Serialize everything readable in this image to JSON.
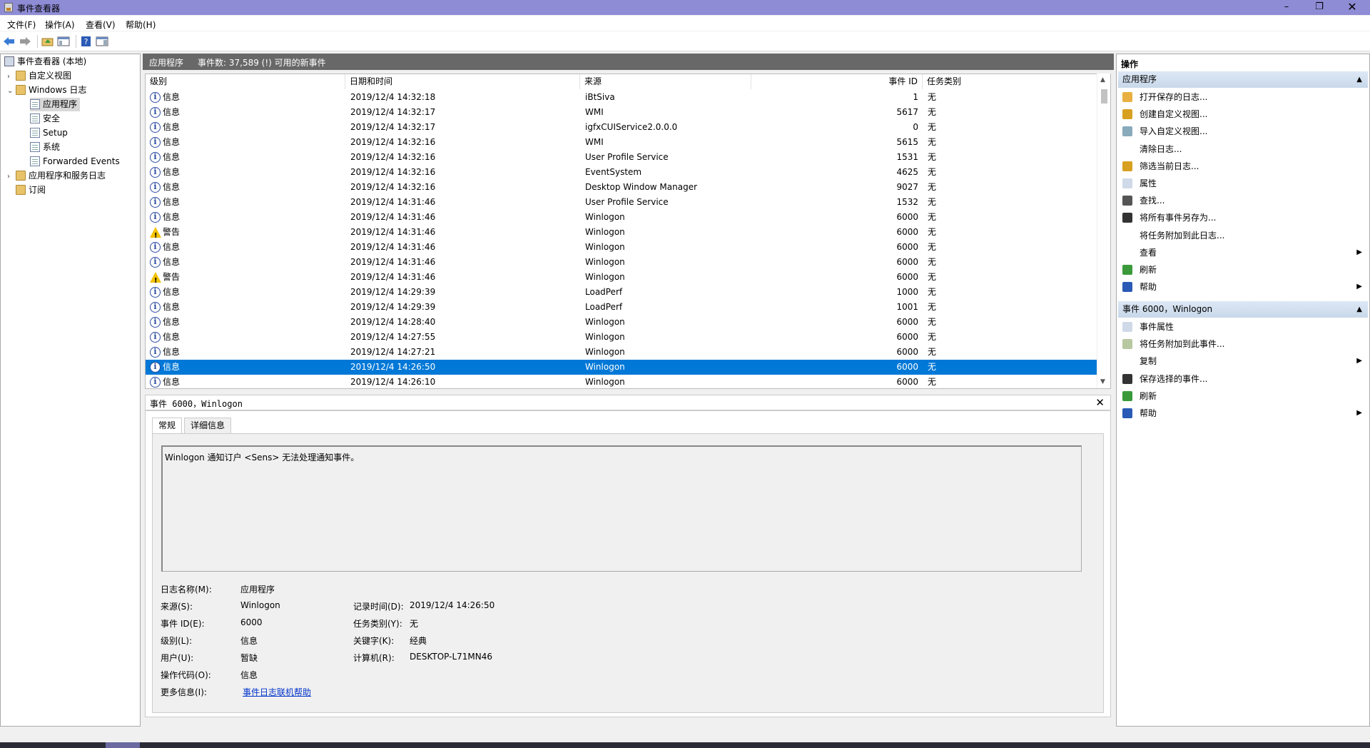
{
  "window": {
    "title": "事件查看器"
  },
  "menu": [
    "文件(F)",
    "操作(A)",
    "查看(V)",
    "帮助(H)"
  ],
  "tree": {
    "root": "事件查看器 (本地)",
    "custom_views": "自定义视图",
    "windows_logs": "Windows 日志",
    "logs": [
      "应用程序",
      "安全",
      "Setup",
      "系统",
      "Forwarded Events"
    ],
    "apps_services": "应用程序和服务日志",
    "subscriptions": "订阅"
  },
  "center_header": {
    "title": "应用程序",
    "count": "事件数: 37,589 (!) 可用的新事件"
  },
  "columns": [
    "级别",
    "日期和时间",
    "来源",
    "事件 ID",
    "任务类别"
  ],
  "events": [
    {
      "level": "信息",
      "type": "info",
      "date": "2019/12/4 14:32:18",
      "source": "iBtSiva",
      "id": "1",
      "task": "无"
    },
    {
      "level": "信息",
      "type": "info",
      "date": "2019/12/4 14:32:17",
      "source": "WMI",
      "id": "5617",
      "task": "无"
    },
    {
      "level": "信息",
      "type": "info",
      "date": "2019/12/4 14:32:17",
      "source": "igfxCUIService2.0.0.0",
      "id": "0",
      "task": "无"
    },
    {
      "level": "信息",
      "type": "info",
      "date": "2019/12/4 14:32:16",
      "source": "WMI",
      "id": "5615",
      "task": "无"
    },
    {
      "level": "信息",
      "type": "info",
      "date": "2019/12/4 14:32:16",
      "source": "User Profile Service",
      "id": "1531",
      "task": "无"
    },
    {
      "level": "信息",
      "type": "info",
      "date": "2019/12/4 14:32:16",
      "source": "EventSystem",
      "id": "4625",
      "task": "无"
    },
    {
      "level": "信息",
      "type": "info",
      "date": "2019/12/4 14:32:16",
      "source": "Desktop Window Manager",
      "id": "9027",
      "task": "无"
    },
    {
      "level": "信息",
      "type": "info",
      "date": "2019/12/4 14:31:46",
      "source": "User Profile Service",
      "id": "1532",
      "task": "无"
    },
    {
      "level": "信息",
      "type": "info",
      "date": "2019/12/4 14:31:46",
      "source": "Winlogon",
      "id": "6000",
      "task": "无"
    },
    {
      "level": "警告",
      "type": "warn",
      "date": "2019/12/4 14:31:46",
      "source": "Winlogon",
      "id": "6000",
      "task": "无"
    },
    {
      "level": "信息",
      "type": "info",
      "date": "2019/12/4 14:31:46",
      "source": "Winlogon",
      "id": "6000",
      "task": "无"
    },
    {
      "level": "信息",
      "type": "info",
      "date": "2019/12/4 14:31:46",
      "source": "Winlogon",
      "id": "6000",
      "task": "无"
    },
    {
      "level": "警告",
      "type": "warn",
      "date": "2019/12/4 14:31:46",
      "source": "Winlogon",
      "id": "6000",
      "task": "无"
    },
    {
      "level": "信息",
      "type": "info",
      "date": "2019/12/4 14:29:39",
      "source": "LoadPerf",
      "id": "1000",
      "task": "无"
    },
    {
      "level": "信息",
      "type": "info",
      "date": "2019/12/4 14:29:39",
      "source": "LoadPerf",
      "id": "1001",
      "task": "无"
    },
    {
      "level": "信息",
      "type": "info",
      "date": "2019/12/4 14:28:40",
      "source": "Winlogon",
      "id": "6000",
      "task": "无"
    },
    {
      "level": "信息",
      "type": "info",
      "date": "2019/12/4 14:27:55",
      "source": "Winlogon",
      "id": "6000",
      "task": "无"
    },
    {
      "level": "信息",
      "type": "info",
      "date": "2019/12/4 14:27:21",
      "source": "Winlogon",
      "id": "6000",
      "task": "无"
    },
    {
      "level": "信息",
      "type": "info",
      "date": "2019/12/4 14:26:50",
      "source": "Winlogon",
      "id": "6000",
      "task": "无",
      "selected": true
    },
    {
      "level": "信息",
      "type": "info",
      "date": "2019/12/4 14:26:10",
      "source": "Winlogon",
      "id": "6000",
      "task": "无"
    }
  ],
  "detail": {
    "header": "事件 6000，Winlogon",
    "tabs": [
      "常规",
      "详细信息"
    ],
    "description": "Winlogon 通知订户 <Sens> 无法处理通知事件。",
    "labels": {
      "log_name": "日志名称(M):",
      "source": "来源(S):",
      "event_id": "事件 ID(E):",
      "level": "级别(L):",
      "user": "用户(U):",
      "opcode": "操作代码(O):",
      "more_info": "更多信息(I):",
      "logged": "记录时间(D):",
      "task": "任务类别(Y):",
      "keywords": "关键字(K):",
      "computer": "计算机(R):"
    },
    "values": {
      "log_name": "应用程序",
      "source": "Winlogon",
      "event_id": "6000",
      "level": "信息",
      "user": "暂缺",
      "opcode": "信息",
      "more_info": "事件日志联机帮助",
      "logged": "2019/12/4 14:26:50",
      "task": "无",
      "keywords": "经典",
      "computer": "DESKTOP-L71MN46"
    }
  },
  "actions": {
    "title": "操作",
    "section1": "应用程序",
    "items1": [
      "打开保存的日志...",
      "创建自定义视图...",
      "导入自定义视图...",
      "清除日志...",
      "筛选当前日志...",
      "属性",
      "查找...",
      "将所有事件另存为...",
      "将任务附加到此日志...",
      "查看",
      "刷新",
      "帮助"
    ],
    "section2": "事件 6000，Winlogon",
    "items2": [
      "事件属性",
      "将任务附加到此事件...",
      "复制",
      "保存选择的事件...",
      "刷新",
      "帮助"
    ]
  }
}
